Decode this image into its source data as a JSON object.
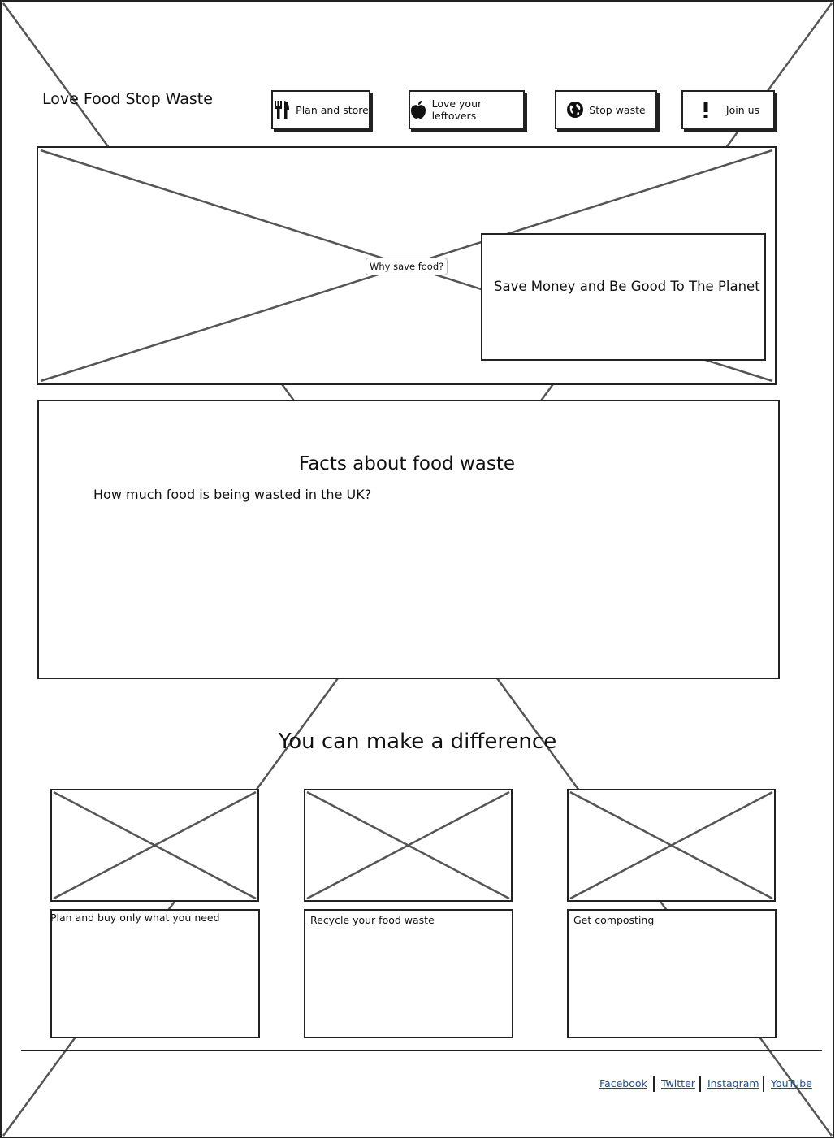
{
  "header": {
    "site_title": "Love Food Stop Waste"
  },
  "nav": [
    {
      "label": "Plan and store",
      "icon": "fork-knife-icon"
    },
    {
      "label": "Love your leftovers",
      "icon": "apple-icon"
    },
    {
      "label": "Stop waste",
      "icon": "globe-icon"
    },
    {
      "label": "Join us",
      "icon": "exclamation-icon"
    }
  ],
  "hero": {
    "image_label": "Why save food?",
    "overlay_text": "Save Money and Be Good To The Planet"
  },
  "facts": {
    "title": "Facts about food waste",
    "question": "How much food is being wasted in the UK?"
  },
  "difference": {
    "title": "You can make a difference",
    "cards": [
      {
        "caption": "Plan and buy only what you need"
      },
      {
        "caption": "Recycle your food waste"
      },
      {
        "caption": "Get composting"
      }
    ]
  },
  "footer": {
    "links": [
      "Facebook",
      "Twitter",
      "Instagram",
      "YouTube"
    ]
  },
  "colors": {
    "outline": "#222222",
    "placeholder_lines": "#555555",
    "link": "#1f4e8c"
  }
}
